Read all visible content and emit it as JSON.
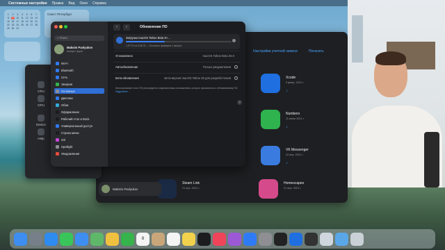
{
  "menubar": {
    "items": [
      "Системные настройки",
      "Правка",
      "Вид",
      "Окно",
      "Справка"
    ]
  },
  "calendar": {
    "days": [
      "1",
      "2",
      "3",
      "4",
      "5",
      "6",
      "7",
      "8",
      "9",
      "10",
      "11",
      "12",
      "13",
      "14",
      "15",
      "16",
      "17",
      "18",
      "19",
      "20",
      "21",
      "22",
      "23",
      "24",
      "25",
      "26",
      "27",
      "28",
      "29",
      "30",
      "31"
    ],
    "today": "9"
  },
  "weather": {
    "city": "Санкт-Петербург"
  },
  "settings": {
    "search_placeholder": "Поиск",
    "account": {
      "name": "Maksim Pavlyukov",
      "sub": "Аккаунт Apple"
    },
    "sidebar_items": [
      {
        "label": "Wi-Fi",
        "color": "#2f7bf5"
      },
      {
        "label": "Bluetooth",
        "color": "#2f7bf5"
      },
      {
        "label": "Сеть",
        "color": "#2f7bf5"
      },
      {
        "label": "Энергия",
        "color": "#36b34a"
      },
      {
        "label": "Основные",
        "color": "#8e8e93",
        "selected": true
      },
      {
        "label": "Дисплеи",
        "color": "#2f7bf5"
      },
      {
        "label": "Обои",
        "color": "#34aadc"
      },
      {
        "label": "Оформление",
        "color": "#1c1c1e"
      },
      {
        "label": "Рабочий стол и Dock",
        "color": "#1c1c1e"
      },
      {
        "label": "Универсальный доступ",
        "color": "#2f7bf5"
      },
      {
        "label": "Строка меню",
        "color": "#1c1c1e"
      },
      {
        "label": "Siri",
        "color": "#c547d6"
      },
      {
        "label": "Spotlight",
        "color": "#8e8e93"
      },
      {
        "label": "Уведомления",
        "color": "#e74c3c"
      }
    ],
    "title": "Обновление ПО",
    "update": {
      "title": "Загрузка macOS Tahoe Beta 8+...",
      "status": "1,97 ГБ из 5,36 ГБ — Осталось примерно 1 минута",
      "progress": 0.37
    },
    "rows": [
      {
        "key": "Установлено",
        "value": "macOS Tahoe Beta 26.0"
      },
      {
        "key": "Автообновление",
        "value": "Только уведомления"
      },
      {
        "key": "Бета-обновления",
        "value": "Бета-версия macOS Tahoe 26 для разработчиков"
      }
    ],
    "note": "Использование этого ПО регулируется лицензионным соглашением, которое прилагалось к обновляемому ПО.",
    "note_link": "Подробнее…",
    "help": "?"
  },
  "leftwin": {
    "items": [
      "CPU",
      "GPU",
      "Device",
      "Help"
    ]
  },
  "appstore": {
    "links": [
      "Настройки учетной записи",
      "Погасить"
    ],
    "apps": [
      {
        "name": "Xcode",
        "date": "9 февр. 2021 г.",
        "color": "#1f6fe0"
      },
      {
        "name": "Numbers",
        "date": "11 июня 2021 г.",
        "color": "#2eb34f"
      },
      {
        "name": "VK Messenger",
        "date": "22 апр. 2021 г.",
        "color": "#3a7be0"
      },
      {
        "name": "Steam Link",
        "date": "21 апр. 2021 г.",
        "color": "#1a2a45"
      },
      {
        "name": "Homescapes",
        "date": "21 апр. 2021 г.",
        "color": "#d44a8a"
      }
    ],
    "cloud_icon": "↓",
    "user": "Maksim Pavlyukov"
  },
  "dock": {
    "calendar_day": "8",
    "apps": [
      {
        "name": "finder-icon",
        "color": "#3d8ef0"
      },
      {
        "name": "launchpad-icon",
        "color": "#777f8a"
      },
      {
        "name": "safari-icon",
        "color": "#2e8bf0"
      },
      {
        "name": "messages-icon",
        "color": "#3ac55b"
      },
      {
        "name": "mail-icon",
        "color": "#3d8ef0"
      },
      {
        "name": "maps-icon",
        "color": "#5fb86a"
      },
      {
        "name": "photos-icon",
        "color": "#f0c040"
      },
      {
        "name": "facetime-icon",
        "color": "#36b34a"
      },
      {
        "name": "calendar-icon",
        "color": "#f4f4f4"
      },
      {
        "name": "contacts-icon",
        "color": "#c9a67a"
      },
      {
        "name": "reminders-icon",
        "color": "#f4f4f4"
      },
      {
        "name": "notes-icon",
        "color": "#f2d24d"
      },
      {
        "name": "tv-icon",
        "color": "#1c1c1e"
      },
      {
        "name": "music-icon",
        "color": "#f0445a"
      },
      {
        "name": "podcasts-icon",
        "color": "#9b59d6"
      },
      {
        "name": "appstore-icon",
        "color": "#2f7bf5"
      },
      {
        "name": "settings-icon",
        "color": "#8e8e93"
      },
      {
        "name": "terminal-icon",
        "color": "#222"
      },
      {
        "name": "xcode-icon",
        "color": "#1f6fe0"
      },
      {
        "name": "activity-icon",
        "color": "#333"
      },
      {
        "name": "preview-icon",
        "color": "#cfd6dd"
      },
      {
        "name": "folder-icon",
        "color": "#5aa7e8"
      },
      {
        "name": "trash-icon",
        "color": "#c9d0d6"
      }
    ]
  }
}
